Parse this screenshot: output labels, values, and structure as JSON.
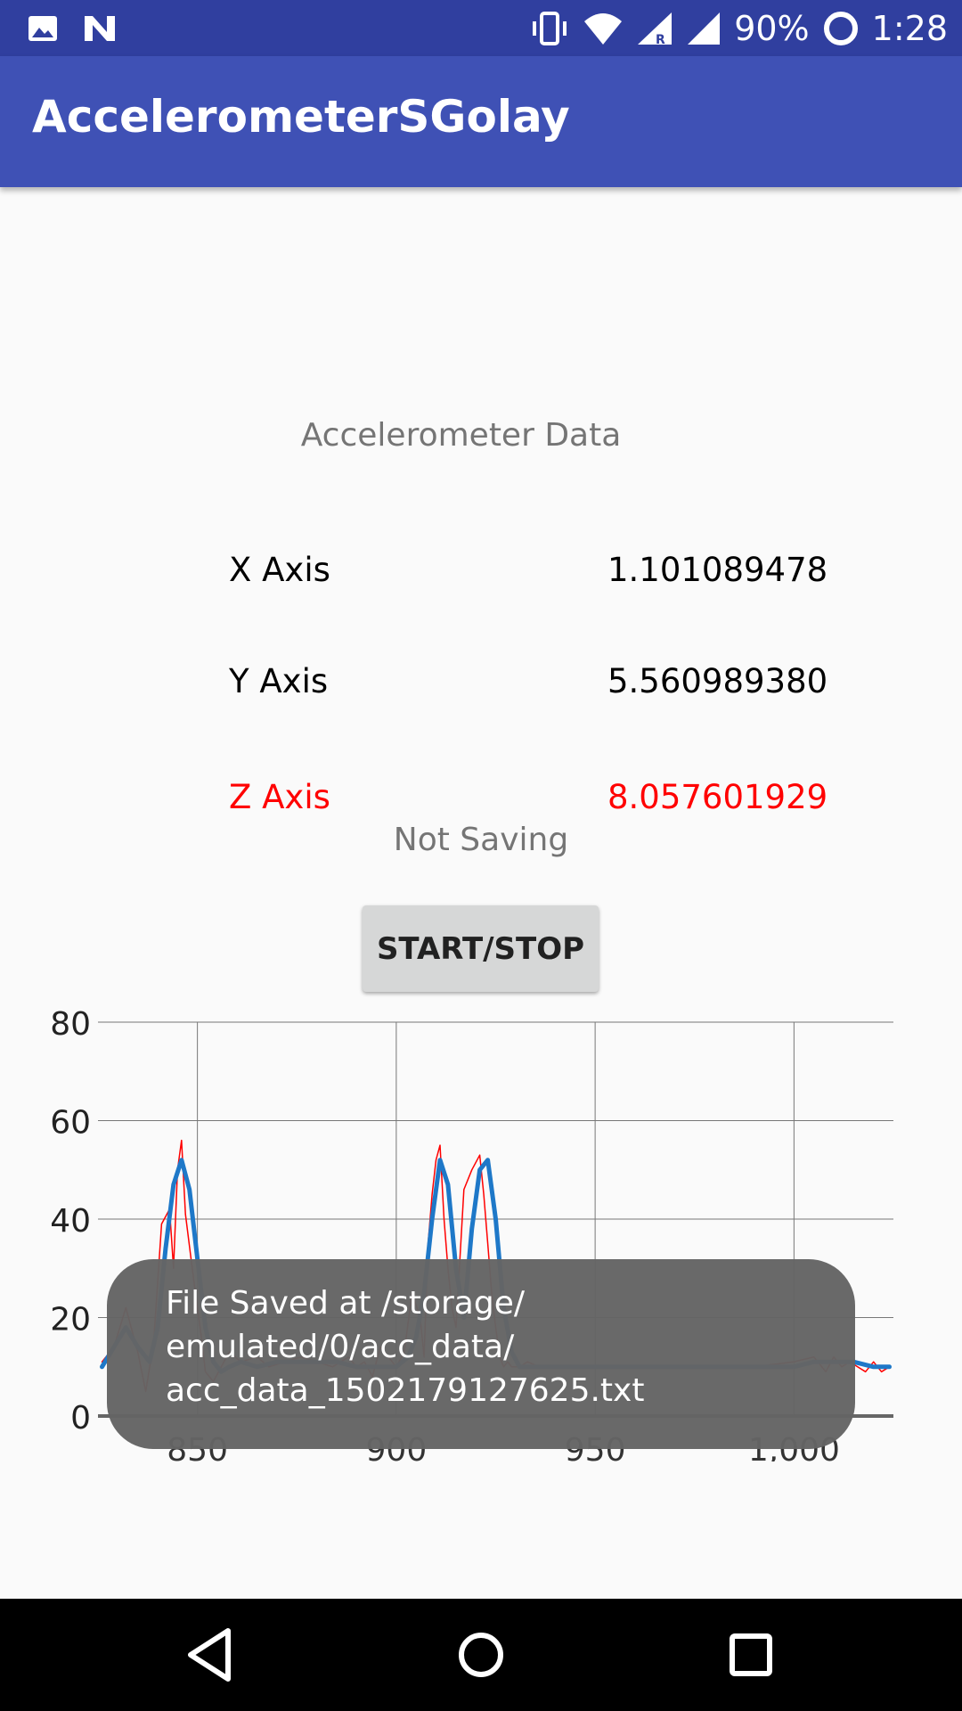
{
  "status_bar": {
    "battery": "90%",
    "time": "1:28"
  },
  "app": {
    "title": "AccelerometerSGolay"
  },
  "sensor": {
    "heading": "Accelerometer Data",
    "rows": [
      {
        "label": "X Axis",
        "value": "1.101089478"
      },
      {
        "label": "Y Axis",
        "value": "5.560989380"
      },
      {
        "label": "Z Axis",
        "value": "8.057601929",
        "color": "#ff0000"
      }
    ],
    "saving_status": "Not Saving",
    "button_label": "START/STOP"
  },
  "toast": {
    "message": "File Saved at /storage/\nemulated/0/acc_data/\nacc_data_1502179127625.txt"
  },
  "chart_data": {
    "type": "line",
    "ylim": [
      0,
      80
    ],
    "xlim": [
      825,
      1025
    ],
    "y_ticks": [
      0,
      20,
      40,
      60,
      80
    ],
    "x_tick_labels": [
      "850",
      "900",
      "950",
      "1,000"
    ],
    "x_ticks": [
      850,
      900,
      950,
      1000
    ],
    "grid": true,
    "series": [
      {
        "color": "#ff0000",
        "x": [
          826,
          829,
          832,
          835,
          837,
          839,
          841,
          843,
          844,
          845,
          846,
          847,
          849,
          851,
          852,
          854,
          856,
          858,
          861,
          865,
          868,
          872,
          876,
          880,
          884,
          888,
          890,
          892,
          894,
          896,
          898,
          900,
          902,
          904,
          906,
          907,
          908,
          909,
          910,
          911,
          912,
          913,
          914,
          915,
          917,
          919,
          921,
          922,
          923,
          924,
          925,
          926,
          927,
          928,
          929,
          931,
          933,
          936,
          940,
          945,
          950,
          960,
          970,
          980,
          990,
          1000,
          1005,
          1008,
          1010,
          1012,
          1014,
          1016,
          1018,
          1020,
          1022,
          1024
        ],
        "values": [
          11,
          14,
          22,
          13,
          5,
          15,
          39,
          42,
          30,
          50,
          56,
          41,
          28,
          16,
          9,
          7,
          10,
          13,
          11,
          12,
          10,
          11,
          12,
          11,
          10,
          12,
          10,
          11,
          8,
          14,
          12,
          10,
          13,
          25,
          20,
          12,
          35,
          45,
          52,
          55,
          40,
          30,
          22,
          18,
          46,
          50,
          53,
          45,
          35,
          25,
          18,
          12,
          10,
          11,
          10,
          10,
          11,
          10,
          10,
          10,
          10,
          10,
          10,
          10,
          10,
          11,
          12,
          9,
          12,
          10,
          11,
          10,
          9,
          11,
          9,
          10
        ]
      },
      {
        "color": "#1e78c8",
        "x": [
          826,
          829,
          832,
          835,
          838,
          840,
          842,
          844,
          846,
          848,
          850,
          852,
          854,
          856,
          858,
          861,
          865,
          870,
          875,
          880,
          885,
          890,
          895,
          900,
          903,
          905,
          907,
          909,
          911,
          913,
          915,
          917,
          919,
          921,
          923,
          925,
          927,
          929,
          931,
          934,
          938,
          945,
          950,
          960,
          970,
          980,
          990,
          1000,
          1005,
          1010,
          1015,
          1020,
          1024
        ],
        "values": [
          10,
          14,
          18,
          14,
          11,
          18,
          34,
          47,
          52,
          46,
          32,
          18,
          11,
          9,
          10,
          11,
          10,
          11,
          11,
          11,
          11,
          10,
          10,
          10,
          12,
          16,
          25,
          40,
          52,
          47,
          30,
          20,
          38,
          50,
          52,
          40,
          22,
          13,
          10,
          10,
          10,
          10,
          10,
          10,
          10,
          10,
          10,
          10,
          11,
          11,
          11,
          10,
          10
        ]
      }
    ]
  }
}
